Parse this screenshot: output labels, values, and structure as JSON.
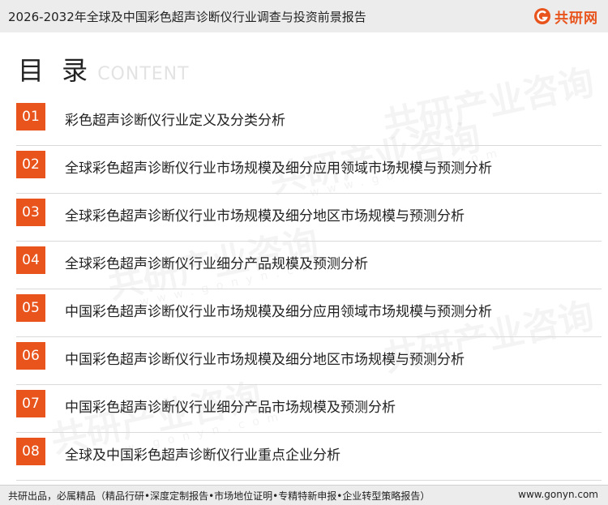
{
  "header": {
    "title": "2026-2032年全球及中国彩色超声诊断仪行业调查与投资前景报告",
    "brand": "共研网"
  },
  "section": {
    "title": "目 录",
    "subtitle": "CONTENT"
  },
  "watermark": {
    "text": "共研产业咨询",
    "url": "www.gonyn.com"
  },
  "toc": [
    {
      "num": "01",
      "label": "彩色超声诊断仪行业定义及分类分析"
    },
    {
      "num": "02",
      "label": "全球彩色超声诊断仪行业市场规模及细分应用领域市场规模与预测分析"
    },
    {
      "num": "03",
      "label": "全球彩色超声诊断仪行业市场规模及细分地区市场规模与预测分析"
    },
    {
      "num": "04",
      "label": "全球彩色超声诊断仪行业细分产品规模及预测分析"
    },
    {
      "num": "05",
      "label": "中国彩色超声诊断仪行业市场规模及细分应用领域市场规模与预测分析"
    },
    {
      "num": "06",
      "label": "中国彩色超声诊断仪行业市场规模及细分地区市场规模与预测分析"
    },
    {
      "num": "07",
      "label": "中国彩色超声诊断仪行业细分产品市场规模及预测分析"
    },
    {
      "num": "08",
      "label": "全球及中国彩色超声诊断仪行业重点企业分析"
    }
  ],
  "footer": {
    "text": "共研出品，必属精品（精品行研•深度定制报告•市场地位证明•专精特新申报•企业转型策略报告）",
    "url": "www.gonyn.com"
  },
  "colors": {
    "accent": "#e8541c",
    "header_bg": "#ececec",
    "divider": "#dadada"
  }
}
